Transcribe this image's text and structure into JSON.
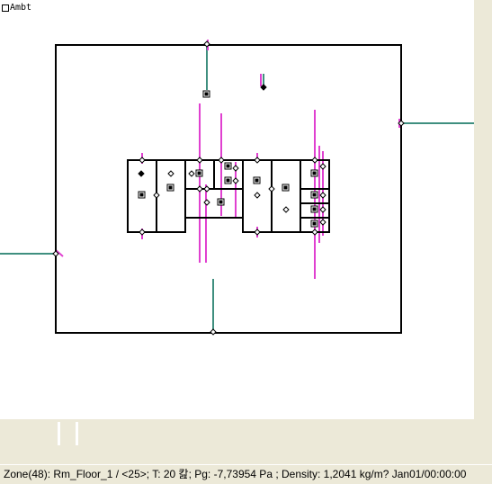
{
  "canvas": {
    "ambient_label": "Ambt",
    "icons": [
      "checkbox-icon",
      "node-diamond-icon",
      "zone-marker-icon"
    ],
    "colors": {
      "background": "#ffffff",
      "wall": "#000000",
      "flow_path": "#3f8f7f",
      "duct_path": "#e040d0"
    }
  },
  "statusbar": {
    "text": "Zone(48): Rm_Floor_1 / <25>; T: 20 캂; Pg: -7,73954 Pa ; Density: 1,2041 kg/m? Jan01/00:00:00"
  }
}
